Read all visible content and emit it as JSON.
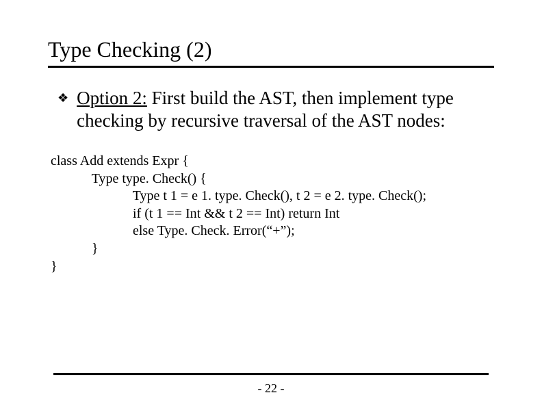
{
  "title": "Type Checking (2)",
  "bullet": {
    "lead": "Option 2:",
    "rest": " First build the AST, then implement type checking by recursive traversal of the AST nodes:"
  },
  "code": {
    "l1": "class Add extends Expr {",
    "l2": "            Type type. Check() {",
    "l3": "                        Type t 1 = e 1. type. Check(), t 2 = e 2. type. Check();",
    "l4": "                        if (t 1 == Int && t 2 == Int) return Int",
    "l5": "                        else Type. Check. Error(“+”);",
    "l6": "            }",
    "l7": "}"
  },
  "pagenum": "- 22 -"
}
